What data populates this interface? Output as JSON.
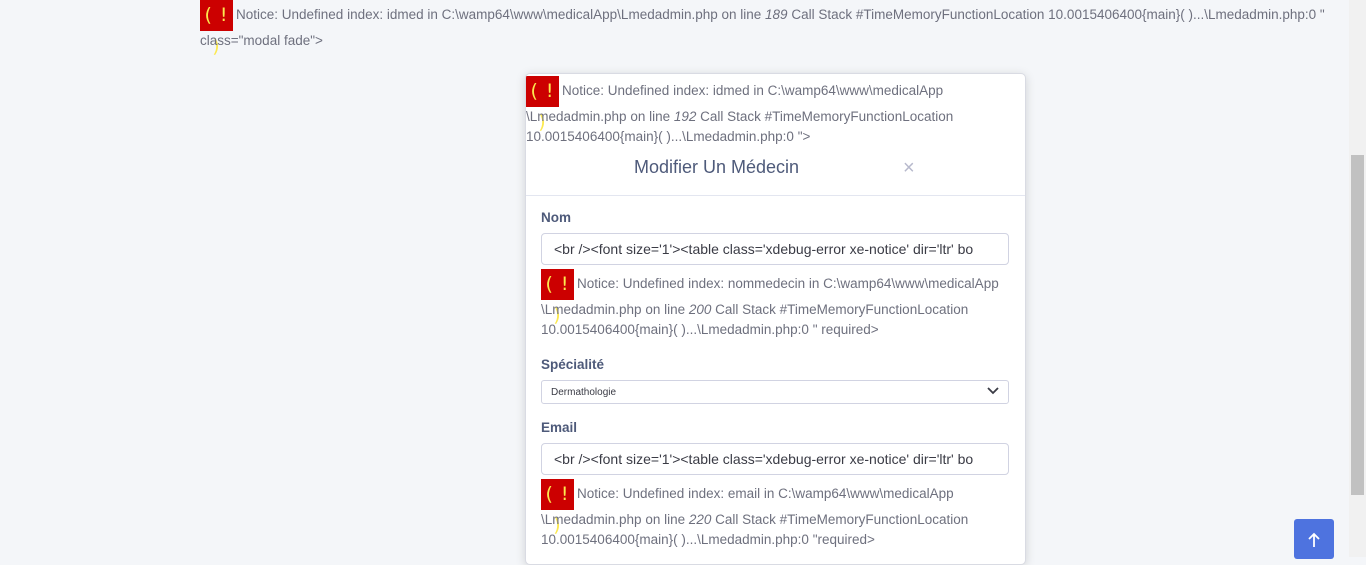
{
  "top_notice": {
    "icon": "( ! )",
    "text_before": "Notice: Undefined index: idmed in C:\\wamp64\\www\\medicalApp\\Lmedadmin.php on line ",
    "line": "189",
    "text_after": " Call Stack #TimeMemoryFunctionLocation 10.0015406400{main}( )...\\Lmedadmin.php:0 \"",
    "line2": "class=\"modal fade\">"
  },
  "modal": {
    "notice": {
      "icon": "( ! )",
      "text_before": "Notice: Undefined index: idmed in C:\\wamp64\\www\\medicalApp \\Lmedadmin.php on line ",
      "line": "192",
      "text_after": " Call Stack #TimeMemoryFunctionLocation 10.0015406400{main}( )...\\Lmedadmin.php:0 \">"
    },
    "title": "Modifier Un Médecin",
    "close_label": "×",
    "fields": {
      "nom": {
        "label": "Nom",
        "value": "<br /><font size='1'><table class='xdebug-error xe-notice' dir='ltr' bo",
        "notice": {
          "icon": "( ! )",
          "text_before": "Notice: Undefined index: nommedecin in C:\\wamp64\\www\\medicalApp \\Lmedadmin.php on line ",
          "line": "200",
          "text_after": " Call Stack #TimeMemoryFunctionLocation 10.0015406400{main}( )...\\Lmedadmin.php:0 \" required>"
        }
      },
      "specialite": {
        "label": "Spécialité",
        "selected": "Dermathologie"
      },
      "email": {
        "label": "Email",
        "value": "<br /><font size='1'><table class='xdebug-error xe-notice' dir='ltr' bo",
        "notice": {
          "icon": "( ! )",
          "text_before": "Notice: Undefined index: email in C:\\wamp64\\www\\medicalApp \\Lmedadmin.php on line ",
          "line": "220",
          "text_after": " Call Stack #TimeMemoryFunctionLocation 10.0015406400{main}( )...\\Lmedadmin.php:0 \"required>"
        }
      }
    }
  },
  "scroll_top_icon": "arrow-up-icon",
  "colors": {
    "accent": "#4e73df",
    "error_bg": "#cc0000",
    "error_fg": "#fce94f"
  }
}
